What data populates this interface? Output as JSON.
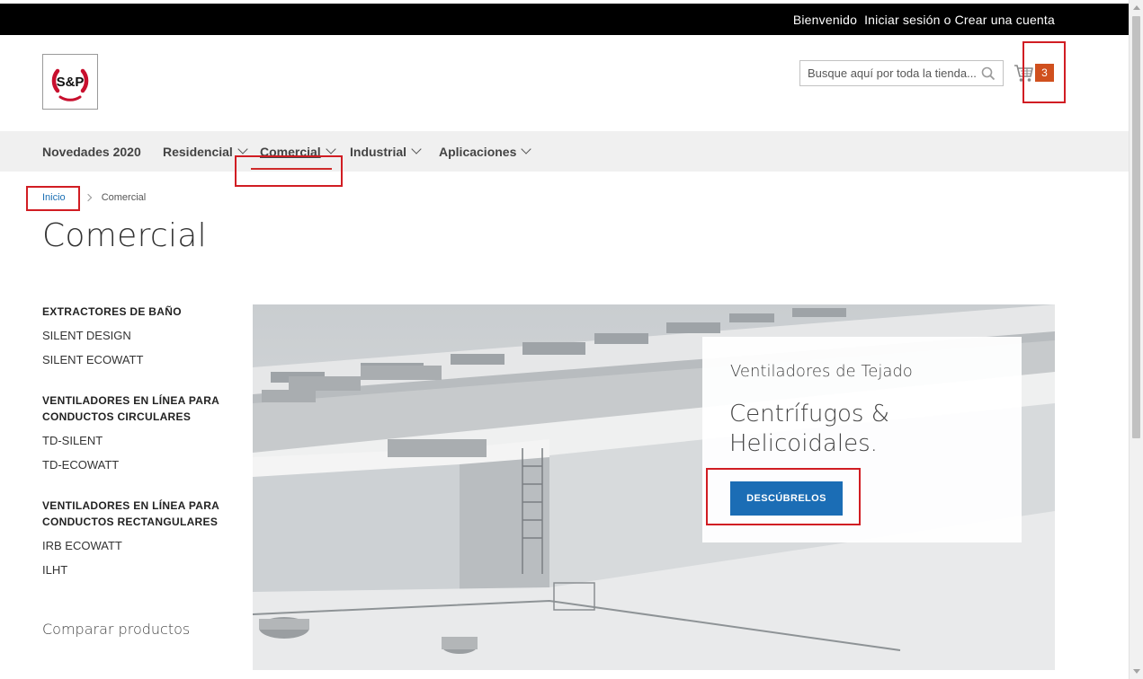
{
  "header": {
    "welcome": "Bienvenido",
    "login": "Iniciar sesión",
    "or": "o",
    "register": "Crear una cuenta"
  },
  "logo": {
    "text": "S&P",
    "color": "#c8102e"
  },
  "search": {
    "placeholder": "Busque aquí por toda la tienda...",
    "icon": "search-icon"
  },
  "cart": {
    "icon": "cart-icon",
    "count": "3",
    "badge_color": "#d0501e"
  },
  "nav": {
    "items": [
      {
        "label": "Novedades 2020",
        "has_dropdown": false
      },
      {
        "label": "Residencial",
        "has_dropdown": true
      },
      {
        "label": "Comercial",
        "has_dropdown": true,
        "active": true
      },
      {
        "label": "Industrial",
        "has_dropdown": true
      },
      {
        "label": "Aplicaciones",
        "has_dropdown": true
      }
    ]
  },
  "breadcrumb": {
    "home": "Inicio",
    "current": "Comercial"
  },
  "page_title": "Comercial",
  "sidebar": {
    "groups": [
      {
        "title": "EXTRACTORES DE BAÑO",
        "items": [
          "SILENT DESIGN",
          "SILENT ECOWATT"
        ]
      },
      {
        "title": "VENTILADORES EN LÍNEA PARA CONDUCTOS CIRCULARES",
        "items": [
          "TD-SILENT",
          "TD-ECOWATT"
        ]
      },
      {
        "title": "VENTILADORES EN LÍNEA PARA CONDUCTOS RECTANGULARES",
        "items": [
          "IRB ECOWATT",
          "ILHT"
        ]
      }
    ],
    "compare": "Comparar productos"
  },
  "promo": {
    "subtitle": "Ventiladores de Tejado",
    "title": "Centrífugos & Helicoidales.",
    "button": "DESCÚBRELOS",
    "button_color": "#1b6db5"
  },
  "colors": {
    "topbar": "#000000",
    "navbar": "#f0f0f0",
    "annotation": "#d11d23",
    "link": "#1a6fb4"
  }
}
